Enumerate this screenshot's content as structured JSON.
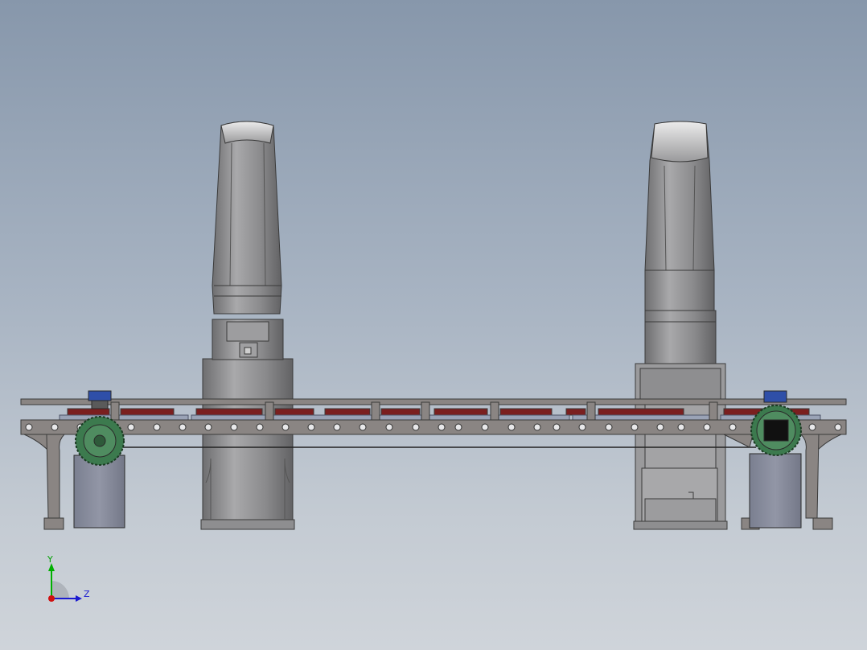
{
  "viewport": {
    "background_top": "#8797ab",
    "background_bottom": "#cfd4da"
  },
  "model": {
    "robot_color": "#8c8c8e",
    "conveyor_frame_color": "#8a8583",
    "conveyor_pad_color": "#7a1f1f",
    "motor_green": "#3c7a4e",
    "motor_blue": "#2f4fa8",
    "base_block_color": "#8a8fa0"
  },
  "triad": {
    "y_label": "Y",
    "z_label": "Z",
    "y_color": "#00b000",
    "z_color": "#1b1bd0",
    "x_color": "#d01010"
  }
}
